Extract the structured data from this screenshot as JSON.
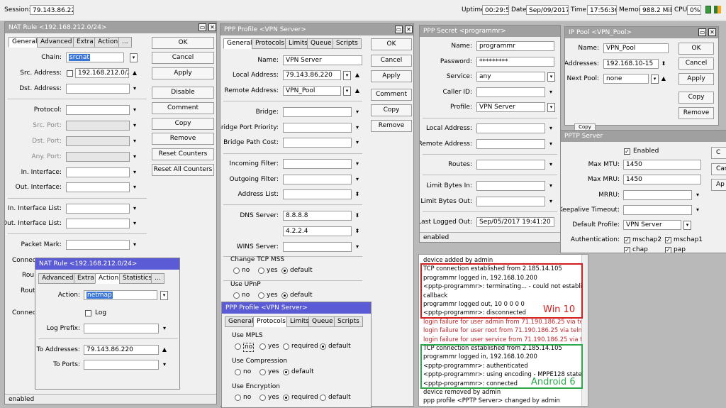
{
  "topbar": {
    "session_label": "Session:",
    "session": "79.143.86.220",
    "uptime_label": "Uptime",
    "uptime": "00:29:51",
    "date_label": "Date",
    "date": "Sep/09/2017",
    "time_label": "Time",
    "time": "17:56:36",
    "memory_label": "Memory",
    "memory": "988.2 MiB",
    "cpu_label": "CPU",
    "cpu": "0%"
  },
  "nat": {
    "title": "NAT Rule <192.168.212.0/24>",
    "tabs": [
      "General",
      "Advanced",
      "Extra",
      "Action",
      "..."
    ],
    "chain_label": "Chain:",
    "chain": "srcnat",
    "src_label": "Src. Address:",
    "src": "192.168.212.0/24",
    "dst_label": "Dst. Address:",
    "protocol_label": "Protocol:",
    "src_port_label": "Src. Port:",
    "dst_port_label": "Dst. Port:",
    "any_port_label": "Any. Port:",
    "in_iface_label": "In. Interface:",
    "out_iface_label": "Out. Interface:",
    "in_list_label": "In. Interface List:",
    "out_list_label": "Out. Interface List:",
    "packet_mark_label": "Packet Mark:",
    "conn_label": "Connec",
    "rou_label": "Rou",
    "rout_label": "Rout",
    "connec2_label": "Connec",
    "buttons": [
      "OK",
      "Cancel",
      "Apply",
      "Disable",
      "Comment",
      "Copy",
      "Remove",
      "Reset Counters",
      "Reset All Counters"
    ],
    "status": "enabled"
  },
  "nat2": {
    "title": "NAT Rule <192.168.212.0/24>",
    "tabs": [
      "Advanced",
      "Extra",
      "Action",
      "Statistics",
      "..."
    ],
    "action_label": "Action:",
    "action": "netmap",
    "log_label": "Log",
    "log_prefix_label": "Log Prefix:",
    "to_addr_label": "To Addresses:",
    "to_addr": "79.143.86.220",
    "to_ports_label": "To Ports:"
  },
  "ppp": {
    "title": "PPP Profile <VPN Server>",
    "tabs": [
      "General",
      "Protocols",
      "Limits",
      "Queue",
      "Scripts"
    ],
    "name_label": "Name:",
    "name": "VPN Server",
    "local_label": "Local Address:",
    "local": "79.143.86.220",
    "remote_label": "Remote Address:",
    "remote": "VPN_Pool",
    "bridge_label": "Bridge:",
    "bpp_label": "Bridge Port Priority:",
    "bpc_label": "Bridge Path Cost:",
    "in_filter_label": "Incoming Filter:",
    "out_filter_label": "Outgoing Filter:",
    "addr_list_label": "Address List:",
    "dns_label": "DNS Server:",
    "dns1": "8.8.8.8",
    "dns2": "4.2.2.4",
    "wins_label": "WINS Server:",
    "tcp_mss_label": "Change TCP MSS",
    "use_upnp_label": "Use UPnP",
    "opt_no": "no",
    "opt_yes": "yes",
    "opt_default": "default",
    "buttons": [
      "OK",
      "Cancel",
      "Apply",
      "Comment",
      "Copy",
      "Remove"
    ]
  },
  "ppp2": {
    "title": "PPP Profile <VPN Server>",
    "tabs": [
      "General",
      "Protocols",
      "Limits",
      "Queue",
      "Scripts"
    ],
    "mpls_label": "Use MPLS",
    "comp_label": "Use Compression",
    "enc_label": "Use Encryption",
    "opt_no": "no",
    "opt_yes": "yes",
    "opt_required": "required",
    "opt_default": "default"
  },
  "secret": {
    "title": "PPP Secret <programmr>",
    "name_label": "Name:",
    "name": "programmr",
    "password_label": "Password:",
    "password": "*********",
    "service_label": "Service:",
    "service": "any",
    "caller_label": "Caller ID:",
    "profile_label": "Profile:",
    "profile": "VPN Server",
    "local_label": "Local Address:",
    "remote_label": "Remote Address:",
    "routes_label": "Routes:",
    "limit_in_label": "Limit Bytes In:",
    "limit_out_label": "Limit Bytes Out:",
    "last_logged_label": "Last Logged Out:",
    "last_logged": "Sep/05/2017 19:41:20",
    "status": "enabled"
  },
  "pool": {
    "title": "IP Pool <VPN_Pool>",
    "name_label": "Name:",
    "name": "VPN_Pool",
    "addr_label": "Addresses:",
    "addr": "192.168.10-15",
    "next_label": "Next Pool:",
    "next": "none",
    "buttons": [
      "OK",
      "Cancel",
      "Apply",
      "Copy",
      "Remove"
    ]
  },
  "pptp": {
    "title": "PPTP Server",
    "enabled_label": "Enabled",
    "mtu_label": "Max MTU:",
    "mtu": "1450",
    "mru_label": "Max MRU:",
    "mru": "1450",
    "mrru_label": "MRRU:",
    "keepalive_label": "Keepalive Timeout:",
    "default_profile_label": "Default Profile:",
    "default_profile": "VPN Server",
    "auth_label": "Authentication:",
    "auth": [
      "mschap2",
      "mschap1",
      "chap",
      "pap"
    ],
    "right_buttons": [
      "C",
      "Car",
      "Ap"
    ],
    "partial_label": "Copy"
  },
  "log": {
    "lines": [
      {
        "t": "device added by admin",
        "c": "black"
      },
      {
        "t": "TCP connection established from 2.185.14.105",
        "c": "black"
      },
      {
        "t": "programmr logged in, 192.168.10.200",
        "c": "black"
      },
      {
        "t": "<pptp-programmr>: terminating... - could not establish",
        "c": "black"
      },
      {
        "t": "callback",
        "c": "black"
      },
      {
        "t": "programmr logged out, 10 0 0 0 0",
        "c": "black"
      },
      {
        "t": "<pptp-programmr>: disconnected",
        "c": "black"
      },
      {
        "t": "login failure for user admin from 71.190.186.25 via telnet",
        "c": "red"
      },
      {
        "t": "login failure for user root from 71.190.186.25 via telnet",
        "c": "red"
      },
      {
        "t": "login failure for user service from 71.190.186.25 via telnet",
        "c": "red"
      },
      {
        "t": "TCP connection established from 2.185.14.105",
        "c": "black"
      },
      {
        "t": "programmr logged in, 192.168.10.200",
        "c": "black"
      },
      {
        "t": "<pptp-programmr>: authenticated",
        "c": "black"
      },
      {
        "t": "<pptp-programmr>: using encoding - MPPE128 stateless",
        "c": "black"
      },
      {
        "t": "<pptp-programmr>: connected",
        "c": "black"
      },
      {
        "t": "device removed by admin",
        "c": "black"
      },
      {
        "t": "ppp profile <PPTP Server> changed by admin",
        "c": "black"
      }
    ],
    "win10_label": "Win 10",
    "android_label": "Android 6"
  },
  "colors": {
    "title_blue": "#5b5bd6",
    "title_gray": "#a0a0a0",
    "log_red": "#c0242a",
    "box_red": "#d31e1e",
    "box_green": "#2ea84a"
  }
}
